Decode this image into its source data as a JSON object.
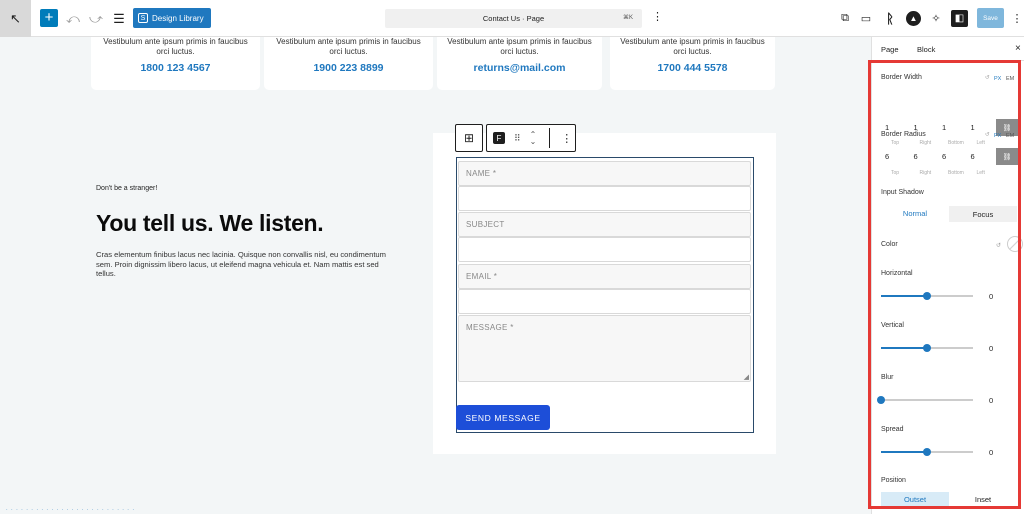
{
  "topbar": {
    "back_icon": "arrow-up-left-icon",
    "add_icon": "plus-icon",
    "undo_icon": "undo-icon",
    "redo_icon": "redo-icon",
    "list_icon": "list-view-icon",
    "design_library_label": "Design Library",
    "doc_title": "Contact Us · Page",
    "doc_shortcut": "⌘K",
    "save_label": "Save",
    "accent": "#1f78bf"
  },
  "cards": [
    {
      "text": "Vestibulum ante ipsum primis in faucibus orci luctus.",
      "value": "1800 123 4567"
    },
    {
      "text": "Vestibulum ante ipsum primis in faucibus orci luctus.",
      "value": "1900 223 8899"
    },
    {
      "text": "Vestibulum ante ipsum primis in faucibus orci luctus.",
      "value": "returns@mail.com"
    },
    {
      "text": "Vestibulum ante ipsum primis in faucibus orci luctus.",
      "value": "1700 444 5578"
    }
  ],
  "intro": {
    "eyebrow": "Don't be a stranger!",
    "headline": "You tell us. We listen.",
    "paragraph": "Cras elementum finibus lacus nec lacinia. Quisque non convallis nisl, eu condimentum sem. Proin dignissim libero lacus, ut eleifend magna vehicula et. Nam mattis est sed tellus."
  },
  "form": {
    "fields": [
      "NAME *",
      "SUBJECT",
      "EMAIL *",
      "MESSAGE *"
    ],
    "submit_label": "SEND MESSAGE",
    "submit_color": "#1d4ed8"
  },
  "panel": {
    "tabs": [
      "Page",
      "Block"
    ],
    "close_icon": "close-icon",
    "border_width": {
      "label": "Border Width",
      "units": [
        "PX",
        "EM"
      ],
      "values": [
        "1",
        "1",
        "1",
        "1"
      ],
      "sub": [
        "Top",
        "Right",
        "Bottom",
        "Left"
      ]
    },
    "border_radius": {
      "label": "Border Radius",
      "units": [
        "PX",
        "EM"
      ],
      "values": [
        "6",
        "6",
        "6",
        "6"
      ],
      "sub": [
        "Top",
        "Right",
        "Bottom",
        "Left"
      ]
    },
    "input_shadow": "Input Shadow",
    "state_tabs": [
      "Normal",
      "Focus"
    ],
    "color_label": "Color",
    "sliders": [
      {
        "label": "Horizontal",
        "value": "0",
        "fraction": 0.5
      },
      {
        "label": "Vertical",
        "value": "0",
        "fraction": 0.5
      },
      {
        "label": "Blur",
        "value": "0",
        "fraction": 0.0
      },
      {
        "label": "Spread",
        "value": "0",
        "fraction": 0.5
      }
    ],
    "position_label": "Position",
    "position_tabs": [
      "Outset",
      "Inset"
    ],
    "highlight_color": "#e53935"
  }
}
